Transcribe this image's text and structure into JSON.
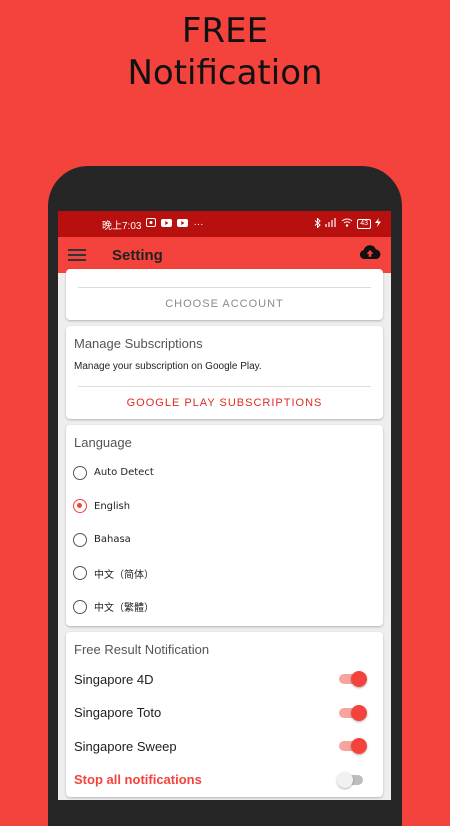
{
  "promo": {
    "line1": "FREE",
    "line2": "Notification"
  },
  "statusbar": {
    "time": "晚上7:03",
    "more": "···",
    "battery": "43"
  },
  "toolbar": {
    "title": "Setting",
    "menu_icon": "hamburger-icon",
    "cloud_icon": "cloud-upload-icon"
  },
  "account": {
    "choose_label": "CHOOSE ACCOUNT"
  },
  "subscriptions": {
    "title": "Manage Subscriptions",
    "text": "Manage your subscription on Google Play.",
    "button": "GOOGLE PLAY SUBSCRIPTIONS"
  },
  "language": {
    "title": "Language",
    "selected": "English",
    "options": [
      "Auto Detect",
      "English",
      "Bahasa",
      "中文（简体）",
      "中文（繁體）"
    ]
  },
  "notifications": {
    "title": "Free Result Notification",
    "items": [
      {
        "label": "Singapore 4D",
        "on": true
      },
      {
        "label": "Singapore Toto",
        "on": true
      },
      {
        "label": "Singapore Sweep",
        "on": true
      }
    ],
    "stop_all": {
      "label": "Stop all notifications",
      "on": false
    }
  },
  "colors": {
    "accent": "#f4433c",
    "statusbar": "#b8100f",
    "link_red": "#e02a22",
    "muted": "#8a8a8a"
  }
}
